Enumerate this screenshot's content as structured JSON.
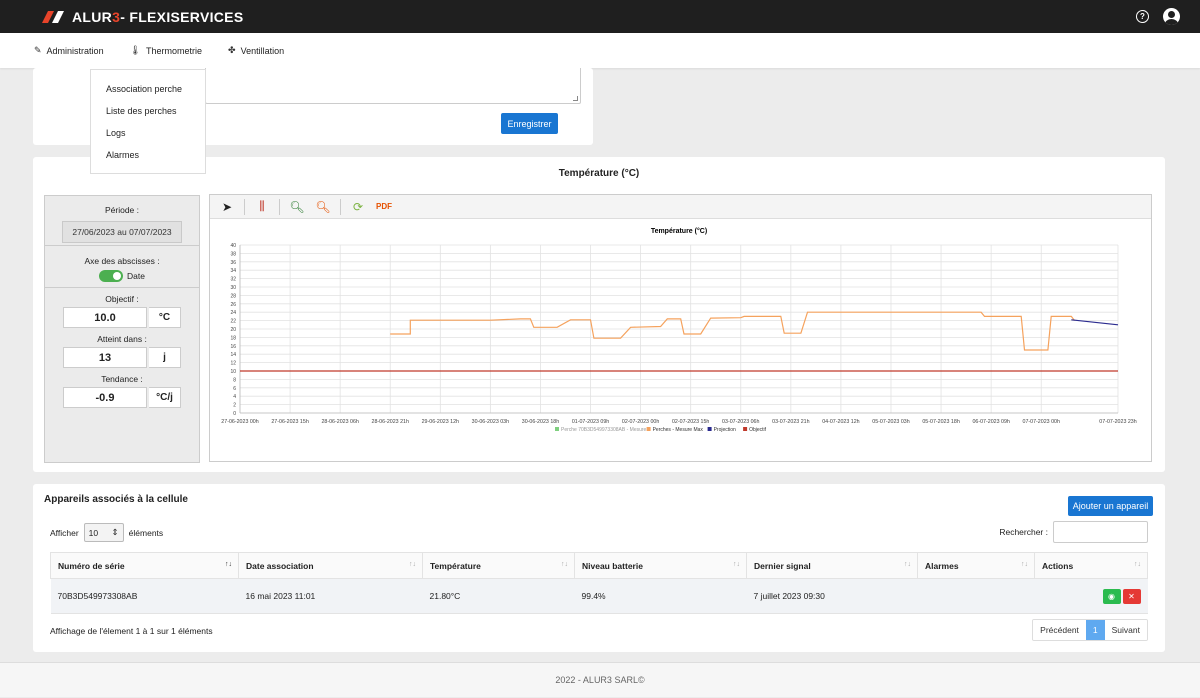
{
  "brand": {
    "name_part1": "ALUR",
    "name_part2": "3",
    "name_part3": " - FLEXISERVICES"
  },
  "nav": [
    {
      "label": "Administration",
      "icon": "pencil-icon"
    },
    {
      "label": "Thermometrie",
      "icon": "thermometer-icon"
    },
    {
      "label": "Ventillation",
      "icon": "fan-icon"
    }
  ],
  "dropdown": [
    "Association perche",
    "Liste des perches",
    "Logs",
    "Alarmes"
  ],
  "form": {
    "save_label": "Enregistrer"
  },
  "temp_card": {
    "title": "Température (°C)",
    "period_label": "Période :",
    "period_value": "27/06/2023 au 07/07/2023",
    "axis_label": "Axe des abscisses :",
    "axis_value": "Date",
    "objectif_label": "Objectif :",
    "objectif_value": "10.0",
    "objectif_unit": "°C",
    "atteint_label": "Atteint dans :",
    "atteint_value": "13",
    "atteint_unit": "j",
    "tendance_label": "Tendance :",
    "tendance_value": "-0.9",
    "tendance_unit": "°C/j"
  },
  "chart_data": {
    "type": "line",
    "title": "Température (°C)",
    "ylim": [
      0,
      40
    ],
    "yticks": [
      0,
      2,
      4,
      6,
      8,
      10,
      12,
      14,
      16,
      18,
      20,
      22,
      24,
      26,
      28,
      30,
      32,
      34,
      36,
      38,
      40
    ],
    "xlim": [
      "27-06-2023 00h",
      "07-07-2023 23h"
    ],
    "xticks": [
      "27-06-2023 00h",
      "27-06-2023 15h",
      "28-06-2023 06h",
      "28-06-2023 21h",
      "29-06-2023 12h",
      "30-06-2023 03h",
      "30-06-2023 18h",
      "01-07-2023 09h",
      "02-07-2023 00h",
      "02-07-2023 15h",
      "03-07-2023 06h",
      "03-07-2023 21h",
      "04-07-2023 12h",
      "05-07-2023 03h",
      "05-07-2023 18h",
      "06-07-2023 09h",
      "07-07-2023 00h",
      "07-07-2023 23h"
    ],
    "grid": true,
    "legend_position": "bottom",
    "series": [
      {
        "name": "Perche 70B3D549973308AB - Mesure",
        "color": "#7fd07f",
        "points": []
      },
      {
        "name": "Perches - Mesure Max",
        "color": "#f5a25d",
        "points": [
          [
            "28-06-2023 21h",
            18.8
          ],
          [
            "28-06-2023 27h",
            18.8
          ],
          [
            "29-06-2023 03h",
            22.1
          ],
          [
            "30-06-2023 03h",
            22.1
          ],
          [
            "30-06-2023 12h",
            22.4
          ],
          [
            "30-06-2023 15h",
            22.4
          ],
          [
            "30-06-2023 16h",
            20.4
          ],
          [
            "30-06-2023 23h",
            20.4
          ],
          [
            "01-07-2023 03h",
            22.2
          ],
          [
            "01-07-2023 09h",
            22.2
          ],
          [
            "01-07-2023 10h",
            17.8
          ],
          [
            "01-07-2023 18h",
            17.8
          ],
          [
            "01-07-2023 21h",
            20.4
          ],
          [
            "02-07-2023 06h",
            20.6
          ],
          [
            "02-07-2023 08h",
            22.4
          ],
          [
            "02-07-2023 12h",
            22.4
          ],
          [
            "02-07-2023 13h",
            18.8
          ],
          [
            "02-07-2023 18h",
            18.8
          ],
          [
            "02-07-2023 21h",
            22.6
          ],
          [
            "03-07-2023 06h",
            22.7
          ],
          [
            "03-07-2023 07h",
            23.0
          ],
          [
            "03-07-2023 18h",
            23.0
          ],
          [
            "03-07-2023 19h",
            19.0
          ],
          [
            "04-07-2023 00h",
            19.0
          ],
          [
            "04-07-2023 02h",
            24.0
          ],
          [
            "06-07-2023 06h",
            24.0
          ],
          [
            "06-07-2023 07h",
            23.0
          ],
          [
            "06-07-2023 18h",
            23.0
          ],
          [
            "06-07-2023 19h",
            15.0
          ],
          [
            "07-07-2023 02h",
            15.0
          ],
          [
            "07-07-2023 03h",
            23.0
          ],
          [
            "07-07-2023 09h",
            23.0
          ],
          [
            "07-07-2023 10h",
            22.0
          ]
        ]
      },
      {
        "name": "Projection",
        "color": "#2b2b8f",
        "points": [
          [
            "07-07-2023 09h",
            22.2
          ],
          [
            "07-07-2023 23h",
            21.0
          ]
        ]
      },
      {
        "name": "Objectif",
        "color": "#c0392b",
        "points": [
          [
            "27-06-2023 00h",
            10.0
          ],
          [
            "07-07-2023 23h",
            10.0
          ]
        ]
      }
    ]
  },
  "devices": {
    "title": "Appareils associés à la cellule",
    "add_label": "Ajouter un appareil",
    "show_prefix": "Afficher",
    "show_value": "10",
    "show_suffix": "éléments",
    "search_label": "Rechercher :",
    "columns": [
      "Numéro de série",
      "Date association",
      "Température",
      "Niveau batterie",
      "Dernier signal",
      "Alarmes",
      "Actions"
    ],
    "rows": [
      [
        "70B3D549973308AB",
        "16 mai 2023 11:01",
        "21.80°C",
        "99.4%",
        "7 juillet 2023 09:30",
        ""
      ]
    ],
    "info": "Affichage de l'élement 1 à 1 sur 1 éléments",
    "prev": "Précédent",
    "page": "1",
    "next": "Suivant"
  },
  "footer": "2022 - ALUR3 SARL©"
}
